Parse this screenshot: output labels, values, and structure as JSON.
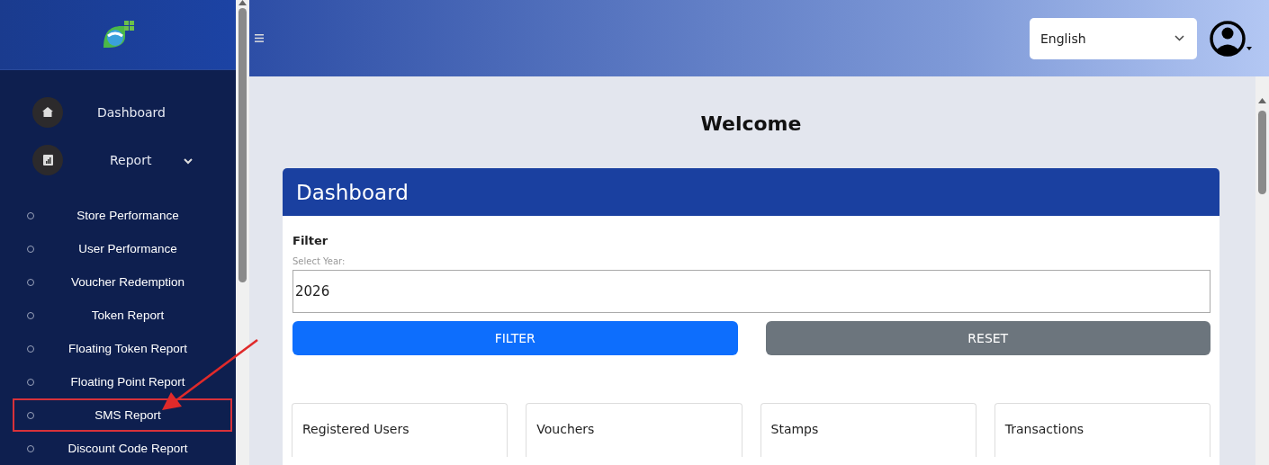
{
  "sidebar": {
    "items": [
      {
        "label": "Dashboard",
        "kind": "link"
      },
      {
        "label": "Report",
        "kind": "group",
        "expanded": true,
        "children": [
          {
            "label": "Store Performance",
            "annotated": false
          },
          {
            "label": "User Performance",
            "annotated": false
          },
          {
            "label": "Voucher Redemption",
            "annotated": false
          },
          {
            "label": "Token Report",
            "annotated": false
          },
          {
            "label": "Floating Token Report",
            "annotated": false
          },
          {
            "label": "Floating Point Report",
            "annotated": false
          },
          {
            "label": "SMS Report",
            "annotated": true
          },
          {
            "label": "Discount Code Report",
            "annotated": false
          }
        ]
      }
    ]
  },
  "topbar": {
    "language": "English"
  },
  "main": {
    "heading": "Welcome",
    "card": {
      "title": "Dashboard",
      "filter_label": "Filter",
      "year_label": "Select Year:",
      "year_value": "2026",
      "buttons": [
        {
          "label": "FILTER",
          "kind": "primary"
        },
        {
          "label": "RESET",
          "kind": "secondary"
        }
      ],
      "stats": [
        {
          "title": "Registered Users"
        },
        {
          "title": "Vouchers"
        },
        {
          "title": "Stamps"
        },
        {
          "title": "Transactions"
        }
      ]
    }
  }
}
